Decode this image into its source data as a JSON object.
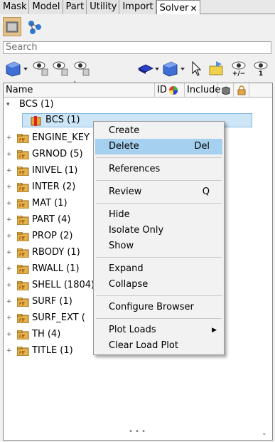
{
  "tabs": [
    "Mask",
    "Model",
    "Part",
    "Utility",
    "Import",
    "Solver"
  ],
  "active_tab_close": "✕",
  "search": {
    "placeholder": "Search"
  },
  "columns": {
    "name": "Name",
    "id": "ID",
    "include": "Include"
  },
  "tree": [
    {
      "label": "BCS  (1)",
      "expanded": true
    },
    {
      "label": "BCS  (1)",
      "child": true,
      "selected": true
    },
    {
      "label": "ENGINE_KEY"
    },
    {
      "label": "GRNOD  (5)"
    },
    {
      "label": "INIVEL  (1)"
    },
    {
      "label": "INTER  (2)"
    },
    {
      "label": "MAT  (1)"
    },
    {
      "label": "PART  (4)"
    },
    {
      "label": "PROP  (2)"
    },
    {
      "label": "RBODY  (1)"
    },
    {
      "label": "RWALL  (1)"
    },
    {
      "label": "SHELL  (1804)"
    },
    {
      "label": "SURF  (1)"
    },
    {
      "label": "SURF_EXT  ("
    },
    {
      "label": "TH  (4)"
    },
    {
      "label": "TITLE  (1)"
    }
  ],
  "context_menu": {
    "create": "Create",
    "delete": "Delete",
    "delete_shortcut": "Del",
    "references": "References",
    "review": "Review",
    "review_shortcut": "Q",
    "hide": "Hide",
    "isolate_only": "Isolate Only",
    "show": "Show",
    "expand": "Expand",
    "collapse": "Collapse",
    "configure_browser": "Configure Browser",
    "plot_loads": "Plot Loads",
    "clear_load_plot": "Clear Load Plot"
  },
  "toolbar2": {
    "plus_minus_label": "+/−",
    "one_label": "1"
  },
  "grip": "• • •",
  "colors": {
    "menu_highlight": "#a6d0ef",
    "tree_selection": "#cde6f7",
    "active_button": "#e3c18a"
  }
}
